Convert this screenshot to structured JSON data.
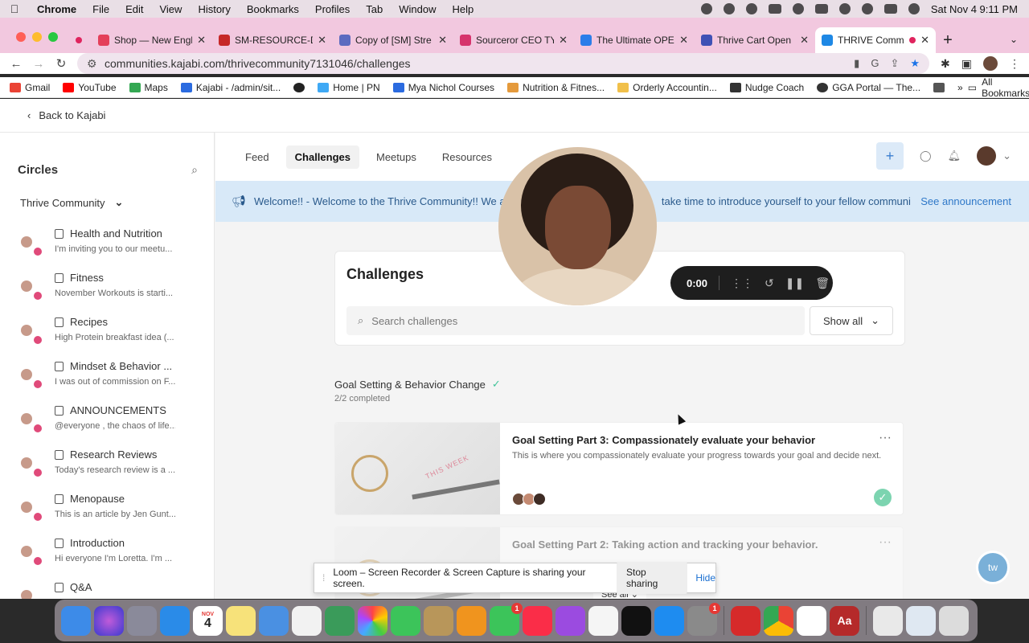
{
  "menubar": {
    "app": "Chrome",
    "items": [
      "File",
      "Edit",
      "View",
      "History",
      "Bookmarks",
      "Profiles",
      "Tab",
      "Window",
      "Help"
    ],
    "datetime": "Sat Nov 4  9:11 PM"
  },
  "tabs": [
    {
      "title": "Shop — New Engl",
      "color": "#e43f5a"
    },
    {
      "title": "SM-RESOURCE-D",
      "color": "#c62828"
    },
    {
      "title": "Copy of [SM] Stre",
      "color": "#5c6bc0"
    },
    {
      "title": "Sourceror CEO TY",
      "color": "#d6336c"
    },
    {
      "title": "The Ultimate OPE",
      "color": "#2b7de9"
    },
    {
      "title": "Thrive Cart Open",
      "color": "#3f51b5"
    },
    {
      "title": "THRIVE Comm",
      "color": "#1e88e5"
    }
  ],
  "address": {
    "url": "communities.kajabi.com/thrivecommunity7131046/challenges"
  },
  "bookmarks": [
    {
      "label": "Gmail",
      "color": "#ea4335"
    },
    {
      "label": "YouTube",
      "color": "#ff0000"
    },
    {
      "label": "Maps",
      "color": "#34a853"
    },
    {
      "label": "Kajabi - /admin/sit...",
      "color": "#2b6be0"
    },
    {
      "label": "",
      "color": "#222222"
    },
    {
      "label": "Home | PN",
      "color": "#3fa9f5"
    },
    {
      "label": "Mya Nichol Courses",
      "color": "#2b6be0"
    },
    {
      "label": "Nutrition & Fitnes...",
      "color": "#e59a3c"
    },
    {
      "label": "Orderly Accountin...",
      "color": "#f1c04a"
    },
    {
      "label": "Nudge Coach",
      "color": "#333333"
    },
    {
      "label": "GGA Portal — The...",
      "color": "#333333"
    },
    {
      "label": "",
      "color": "#555555"
    }
  ],
  "bookmarks_all": "All Bookmarks",
  "back": {
    "label": "Back to Kajabi"
  },
  "sidebar": {
    "title": "Circles",
    "community": "Thrive Community",
    "circles": [
      {
        "name": "Health and Nutrition",
        "desc": "I'm inviting you to our meetu..."
      },
      {
        "name": "Fitness",
        "desc": "November Workouts is starti..."
      },
      {
        "name": "Recipes",
        "desc": "High Protein breakfast idea (..."
      },
      {
        "name": "Mindset & Behavior ...",
        "desc": "I was out of commission on F..."
      },
      {
        "name": "ANNOUNCEMENTS",
        "desc": "@everyone , the chaos of life..."
      },
      {
        "name": "Research Reviews",
        "desc": "Today's research review is a ..."
      },
      {
        "name": "Menopause",
        "desc": "This is an article by Jen Gunt..."
      },
      {
        "name": "Introduction",
        "desc": "Hi everyone I'm Loretta. I'm ..."
      },
      {
        "name": "Q&A",
        "desc": ""
      }
    ]
  },
  "subnav": {
    "tabs": [
      "Feed",
      "Challenges",
      "Meetups",
      "Resources"
    ],
    "active": "Challenges"
  },
  "announcement": {
    "text": "Welcome!! - Welcome to the Thrive Community!! We ar",
    "text_tail": "take time to introduce yourself to your fellow community ...",
    "link": "See announcement"
  },
  "challenges": {
    "title": "Challenges",
    "search_placeholder": "Search challenges",
    "filter": "Show all"
  },
  "section": {
    "title": "Goal Setting & Behavior Change",
    "progress": "2/2 completed"
  },
  "items": [
    {
      "title": "Goal Setting Part 3: Compassionately evaluate your behavior",
      "desc": "This is where you compassionately evaluate your progress towards your goal and decide next...",
      "stamp": "THIS WEEK"
    },
    {
      "title": "Goal Setting Part 2: Taking action and tracking your behavior.",
      "desc": "",
      "stamp": ""
    }
  ],
  "see_all": "See all",
  "loom": {
    "timer": "0:00",
    "share_text": "Loom – Screen Recorder & Screen Capture is sharing your screen.",
    "stop": "Stop sharing",
    "hide": "Hide"
  },
  "chat": {
    "label": "tw"
  },
  "dock": {
    "calendar_month": "NOV",
    "calendar_day": "4",
    "word_label": "Aa"
  }
}
